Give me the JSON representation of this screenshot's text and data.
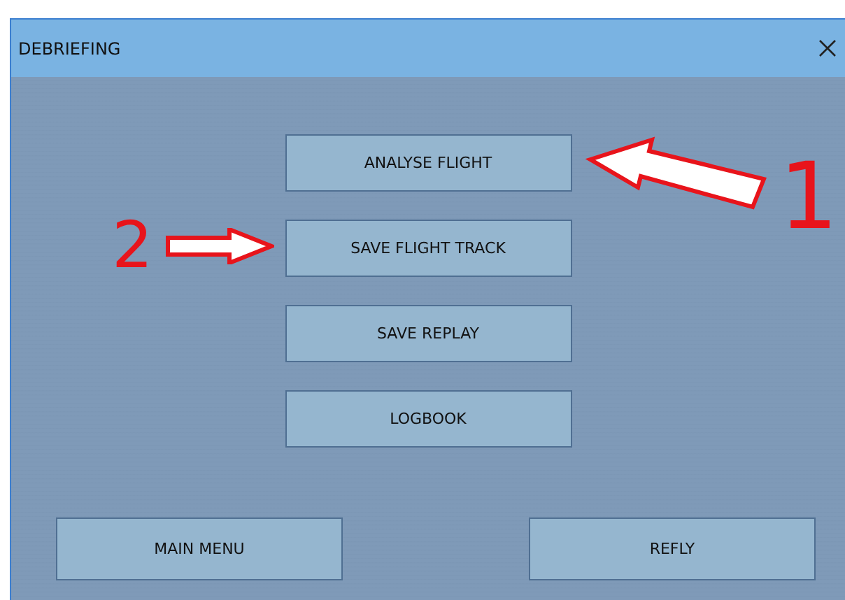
{
  "window": {
    "title": "DEBRIEFING"
  },
  "menu_buttons": [
    {
      "label": "ANALYSE FLIGHT"
    },
    {
      "label": "SAVE FLIGHT TRACK"
    },
    {
      "label": "SAVE REPLAY"
    },
    {
      "label": "LOGBOOK"
    }
  ],
  "bottom_buttons": [
    {
      "label": "MAIN MENU"
    },
    {
      "label": "REFLY"
    }
  ],
  "annotations": [
    {
      "number": "1",
      "kind": "diagonal"
    },
    {
      "number": "2",
      "kind": "horizontal"
    }
  ]
}
